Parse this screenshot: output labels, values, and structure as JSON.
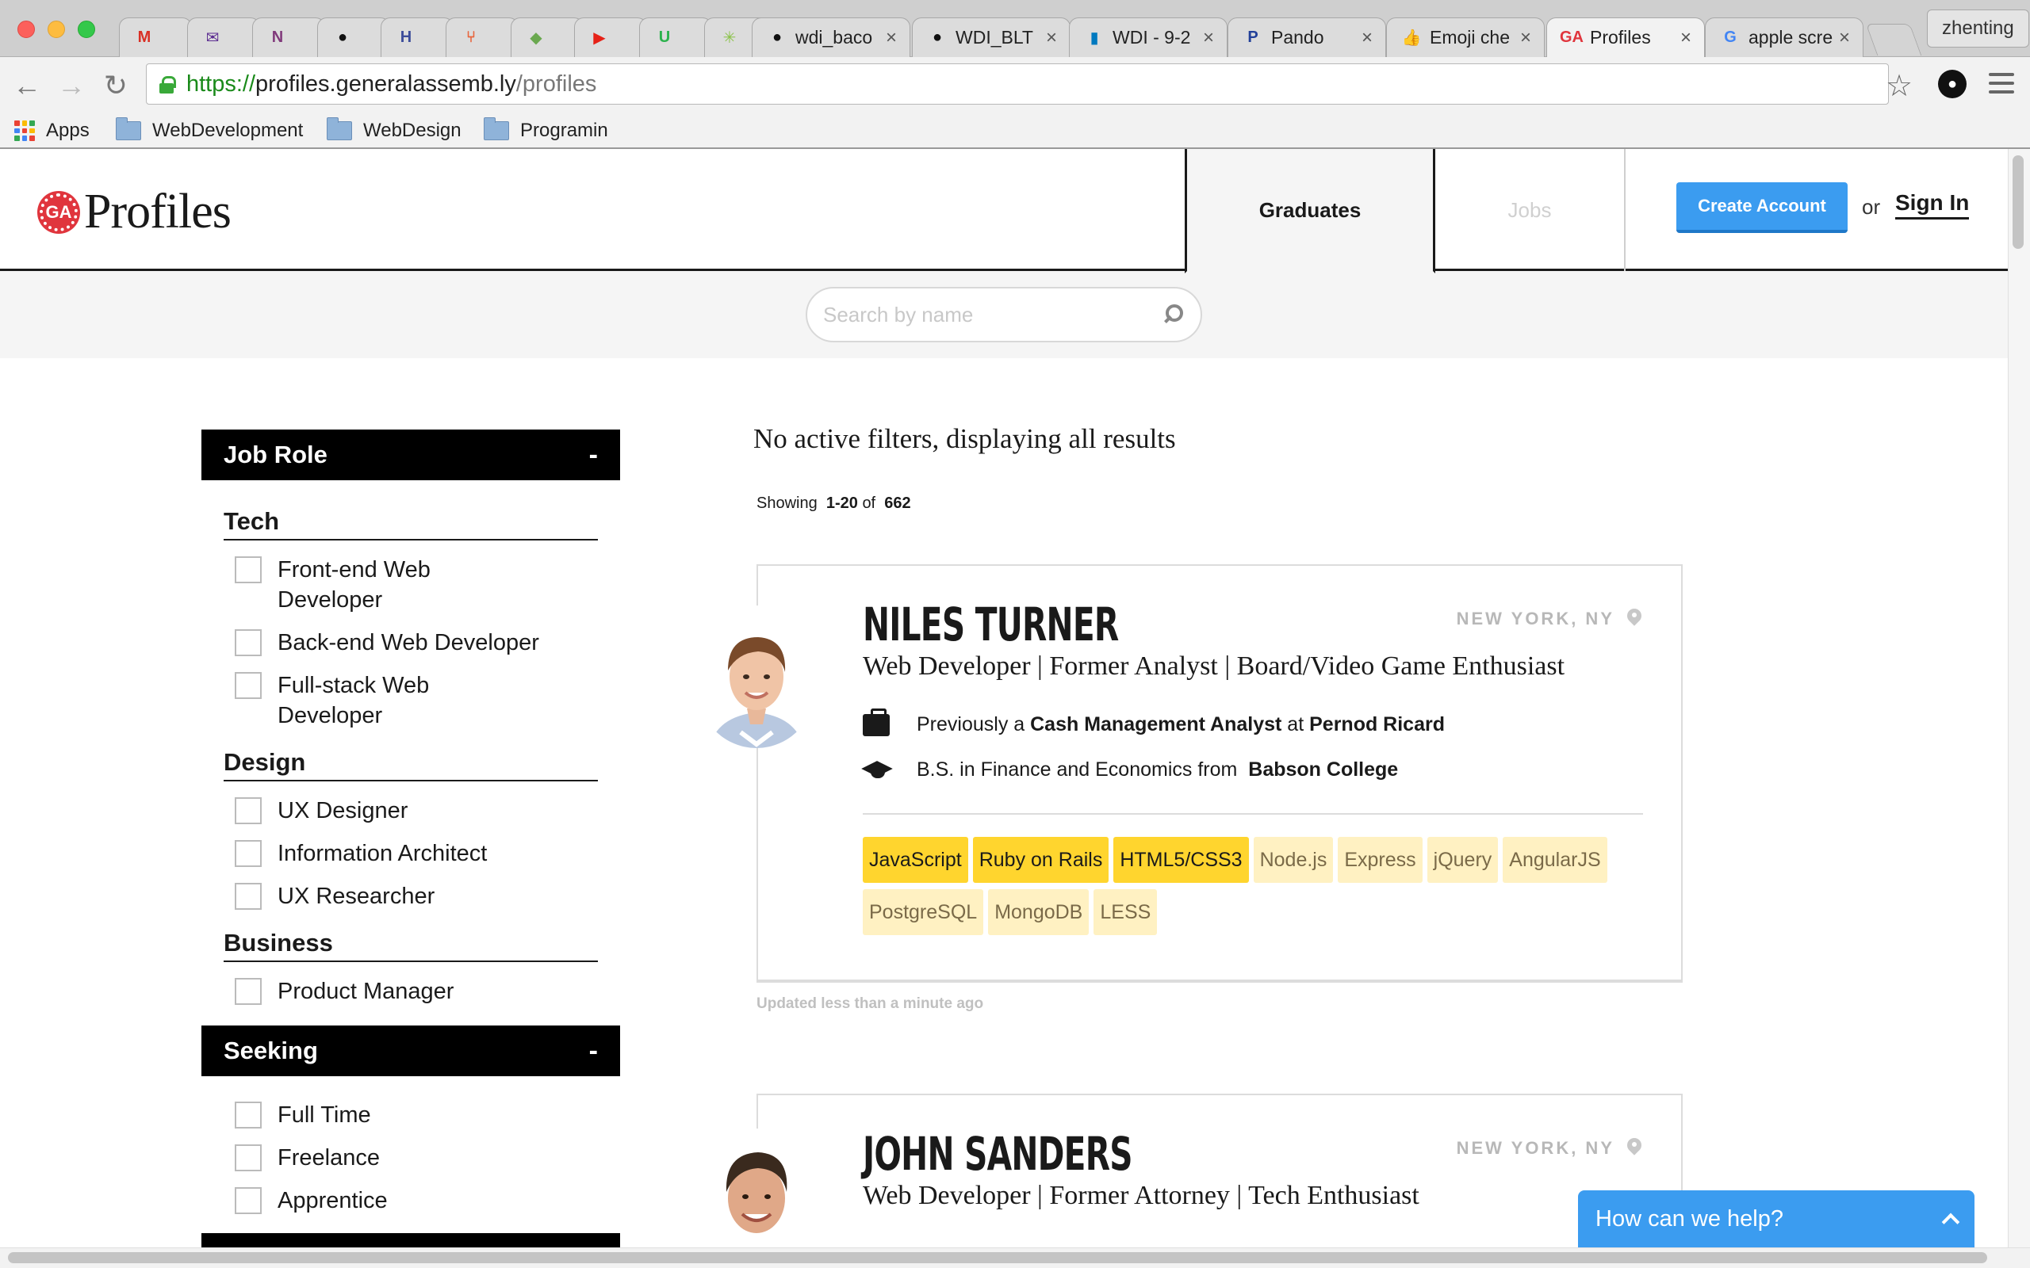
{
  "browser": {
    "tabs": [
      {
        "title": "",
        "favicon": "gmail-icon",
        "color": "#d93025",
        "glyph": "M"
      },
      {
        "title": "",
        "favicon": "yahoo-mail-icon",
        "color": "#5c2d91",
        "glyph": "✉"
      },
      {
        "title": "",
        "favicon": "onenote-icon",
        "color": "#80397b",
        "glyph": "N"
      },
      {
        "title": "",
        "favicon": "github-icon",
        "color": "#111111",
        "glyph": "●"
      },
      {
        "title": "",
        "favicon": "h-icon",
        "color": "#3c4d9a",
        "glyph": "H"
      },
      {
        "title": "",
        "favicon": "fork-icon",
        "color": "#e8643c",
        "glyph": "⑂"
      },
      {
        "title": "",
        "favicon": "box-icon",
        "color": "#6aa84f",
        "glyph": "◆"
      },
      {
        "title": "",
        "favicon": "youtube-icon",
        "color": "#e62117",
        "glyph": "▶"
      },
      {
        "title": "",
        "favicon": "u-icon",
        "color": "#2bb24c",
        "glyph": "U"
      },
      {
        "title": "",
        "favicon": "star-burst-icon",
        "color": "#8bc34a",
        "glyph": "✳"
      },
      {
        "title": "wdi_baco",
        "favicon": "github-icon",
        "color": "#111111",
        "glyph": "●"
      },
      {
        "title": "WDI_BLT",
        "favicon": "github-icon",
        "color": "#111111",
        "glyph": "●"
      },
      {
        "title": "WDI - 9-2",
        "favicon": "trello-icon",
        "color": "#0079bf",
        "glyph": "▮"
      },
      {
        "title": "Pando",
        "favicon": "pandora-icon",
        "color": "#224099",
        "glyph": "P"
      },
      {
        "title": "Emoji che",
        "favicon": "thumbs-up-icon",
        "color": "#f4b400",
        "glyph": "👍"
      },
      {
        "title": "Profiles",
        "favicon": "ga-icon",
        "color": "#e0353d",
        "glyph": "GA"
      },
      {
        "title": "apple scre",
        "favicon": "google-icon",
        "color": "#4285f4",
        "glyph": "G"
      }
    ],
    "profile_name": "zhenting",
    "url": {
      "scheme": "https://",
      "host": "profiles.generalassemb.ly",
      "path": "/profiles"
    },
    "bookmarks": [
      {
        "label": "Apps"
      },
      {
        "label": "WebDevelopment"
      },
      {
        "label": "WebDesign"
      },
      {
        "label": "Programin"
      }
    ]
  },
  "header": {
    "logo_badge": "GA",
    "logo_text": "Profiles",
    "nav": {
      "graduates": "Graduates",
      "jobs": "Jobs"
    },
    "create_account": "Create Account",
    "or": "or",
    "sign_in": "Sign In"
  },
  "search": {
    "placeholder": "Search by name"
  },
  "sidebar": {
    "job_role": {
      "title": "Job Role",
      "toggle": "-",
      "groups": [
        {
          "title": "Tech",
          "options": [
            "Front-end Web Developer",
            "Back-end Web Developer",
            "Full-stack Web Developer"
          ]
        },
        {
          "title": "Design",
          "options": [
            "UX Designer",
            "Information Architect",
            "UX Researcher"
          ]
        },
        {
          "title": "Business",
          "options": [
            "Product Manager"
          ]
        }
      ]
    },
    "seeking": {
      "title": "Seeking",
      "toggle": "-",
      "options": [
        "Full Time",
        "Freelance",
        "Apprentice"
      ]
    }
  },
  "results": {
    "status": "No active filters, displaying all results",
    "showing_prefix": "Showing",
    "range": "1-20",
    "of": "of",
    "total": "662",
    "profiles": [
      {
        "name": "NILES TURNER",
        "location": "NEW YORK, NY",
        "headline": "Web Developer | Former Analyst | Board/Video Game Enthusiast",
        "previously": {
          "prefix": "Previously a",
          "role": "Cash Management Analyst",
          "at": "at",
          "company": "Pernod Ricard"
        },
        "education": {
          "degree": "B.S. in Finance and Economics from",
          "school": "Babson College"
        },
        "primary_skills": [
          "JavaScript",
          "Ruby on Rails",
          "HTML5/CSS3"
        ],
        "secondary_skills": [
          "Node.js",
          "Express",
          "jQuery",
          "AngularJS",
          "PostgreSQL",
          "MongoDB",
          "LESS"
        ],
        "updated": "Updated less than a minute ago"
      },
      {
        "name": "JOHN SANDERS",
        "location": "NEW YORK, NY",
        "headline": "Web Developer | Former Attorney | Tech Enthusiast"
      }
    ]
  },
  "help_widget": {
    "label": "How can we help?"
  },
  "colors": {
    "accent_blue": "#3b9cf0",
    "skill_primary": "#ffd52e",
    "skill_secondary": "#fff1c2",
    "brand_red": "#e0353d"
  }
}
